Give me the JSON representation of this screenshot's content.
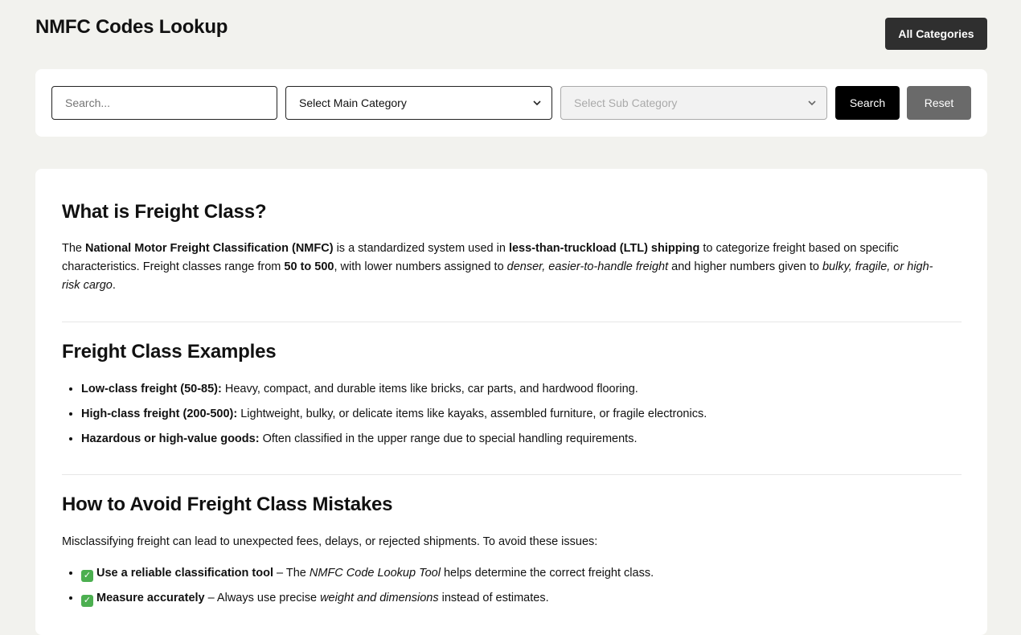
{
  "header": {
    "title": "NMFC Codes Lookup",
    "all_categories_label": "All Categories"
  },
  "search": {
    "placeholder": "Search...",
    "main_category": "Select Main Category",
    "sub_category": "Select Sub Category",
    "search_label": "Search",
    "reset_label": "Reset"
  },
  "section1": {
    "title": "What is Freight Class?",
    "p_1": "The ",
    "p_b1": "National Motor Freight Classification (NMFC)",
    "p_2": " is a standardized system used in ",
    "p_b2": "less-than-truckload (LTL) shipping",
    "p_3": " to categorize freight based on specific characteristics. Freight classes range from ",
    "p_b3": "50 to 500",
    "p_4": ", with lower numbers assigned to ",
    "p_i1": "denser, easier-to-handle freight",
    "p_5": " and higher numbers given to ",
    "p_i2": "bulky, fragile, or high-risk cargo",
    "p_6": "."
  },
  "section2": {
    "title": "Freight Class Examples",
    "items": [
      {
        "label": "Low-class freight (50-85):",
        "text": " Heavy, compact, and durable items like bricks, car parts, and hardwood flooring."
      },
      {
        "label": "High-class freight (200-500):",
        "text": " Lightweight, bulky, or delicate items like kayaks, assembled furniture, or fragile electronics."
      },
      {
        "label": "Hazardous or high-value goods:",
        "text": " Often classified in the upper range due to special handling requirements."
      }
    ]
  },
  "section3": {
    "title": "How to Avoid Freight Class Mistakes",
    "intro": "Misclassifying freight can lead to unexpected fees, delays, or rejected shipments. To avoid these issues:",
    "items": [
      {
        "label": "Use a reliable classification tool",
        "t1": " – The ",
        "em": "NMFC Code Lookup Tool",
        "t2": " helps determine the correct freight class."
      },
      {
        "label": "Measure accurately",
        "t1": " – Always use precise ",
        "em": "weight and dimensions",
        "t2": " instead of estimates."
      }
    ]
  },
  "icons": {
    "check": "check-mark-icon",
    "chevron": "chevron-down-icon"
  }
}
